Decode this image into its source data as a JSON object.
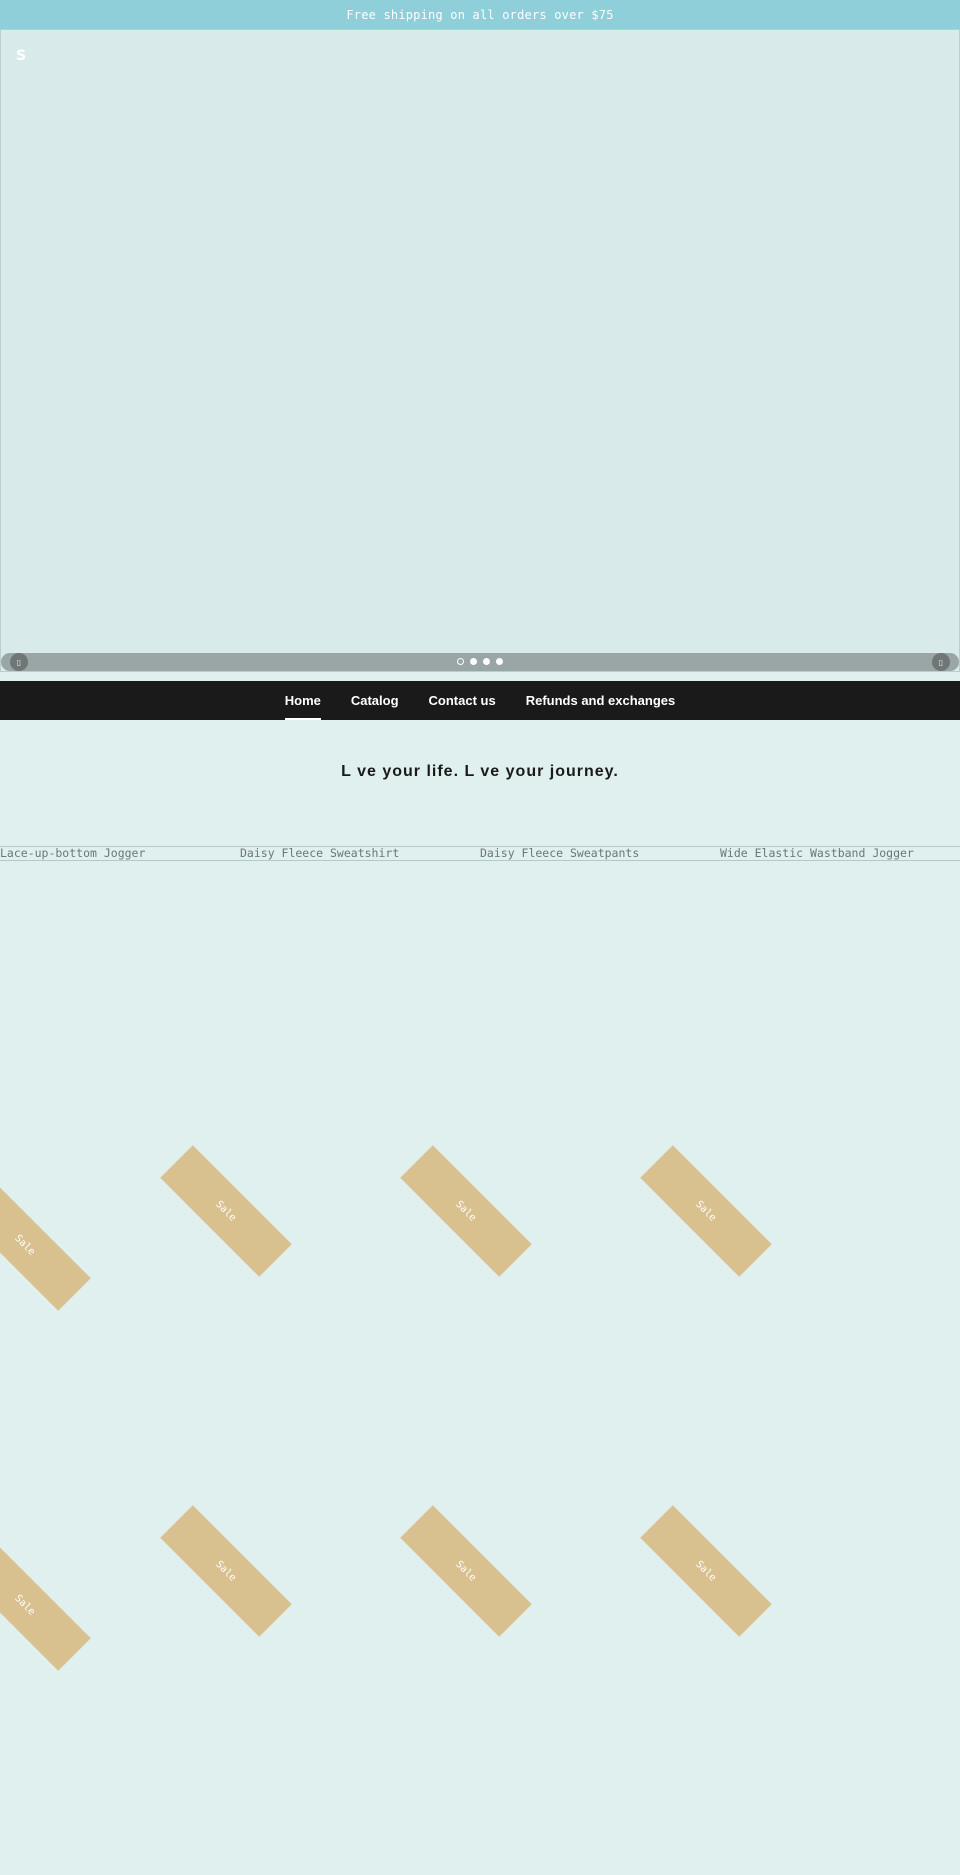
{
  "announcement": {
    "text": "Free shipping on all orders over $75"
  },
  "hero": {
    "logo_text": "S",
    "prev_icon": "chevron-left-icon",
    "next_icon": "chevron-right-icon",
    "prev_glyph": "▯",
    "next_glyph": "▯",
    "dot_count": 4,
    "active_dot": 1
  },
  "nav": {
    "items": [
      {
        "label": "Home",
        "active": true
      },
      {
        "label": "Catalog",
        "active": false
      },
      {
        "label": "Contact us",
        "active": false
      },
      {
        "label": "Refunds and exchanges",
        "active": false
      }
    ]
  },
  "tagline": {
    "text": "L  ve your life. L  ve your journey."
  },
  "products": {
    "titles": [
      "Lace-up-bottom Jogger",
      "Daisy Fleece Sweatshirt",
      "Daisy Fleece Sweatpants",
      "Wide Elastic Wastband Jogger"
    ]
  },
  "sale_badge": {
    "label": "Sale",
    "color": "#d9c08f"
  },
  "colors": {
    "announcement_bg": "#8ecfd9",
    "page_bg": "#e0f0ef",
    "hero_bg": "#d8eae9",
    "nav_bg": "#1a1a1a"
  }
}
